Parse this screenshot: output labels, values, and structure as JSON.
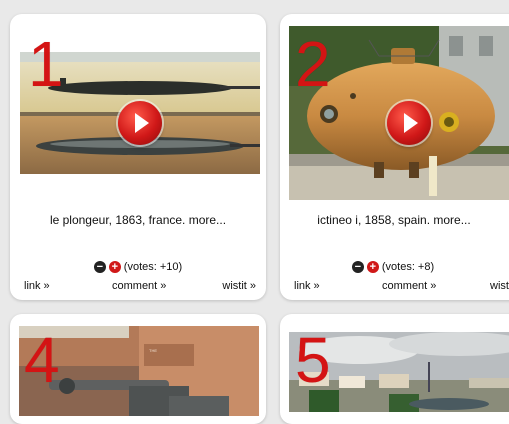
{
  "cards": [
    {
      "rank": "1",
      "caption": "le plongeur, 1863, france. more...",
      "votes": "(votes: +10)",
      "actions": {
        "link": "link »",
        "comment": "comment »",
        "wistit": "wistit »"
      }
    },
    {
      "rank": "2",
      "caption": "ictineo i, 1858, spain. more...",
      "votes": "(votes: +8)",
      "actions": {
        "link": "link »",
        "comment": "comment »",
        "wistit": "wistit »"
      }
    },
    {
      "rank": "4"
    },
    {
      "rank": "5"
    }
  ],
  "vote_buttons": {
    "minus": "−",
    "plus": "+"
  },
  "colors": {
    "rank": "#d41414",
    "play": "#d01818",
    "background": "#e9e9e9"
  },
  "icons": {
    "play": "play-icon",
    "vote_down": "minus-circle-icon",
    "vote_up": "plus-circle-icon"
  }
}
